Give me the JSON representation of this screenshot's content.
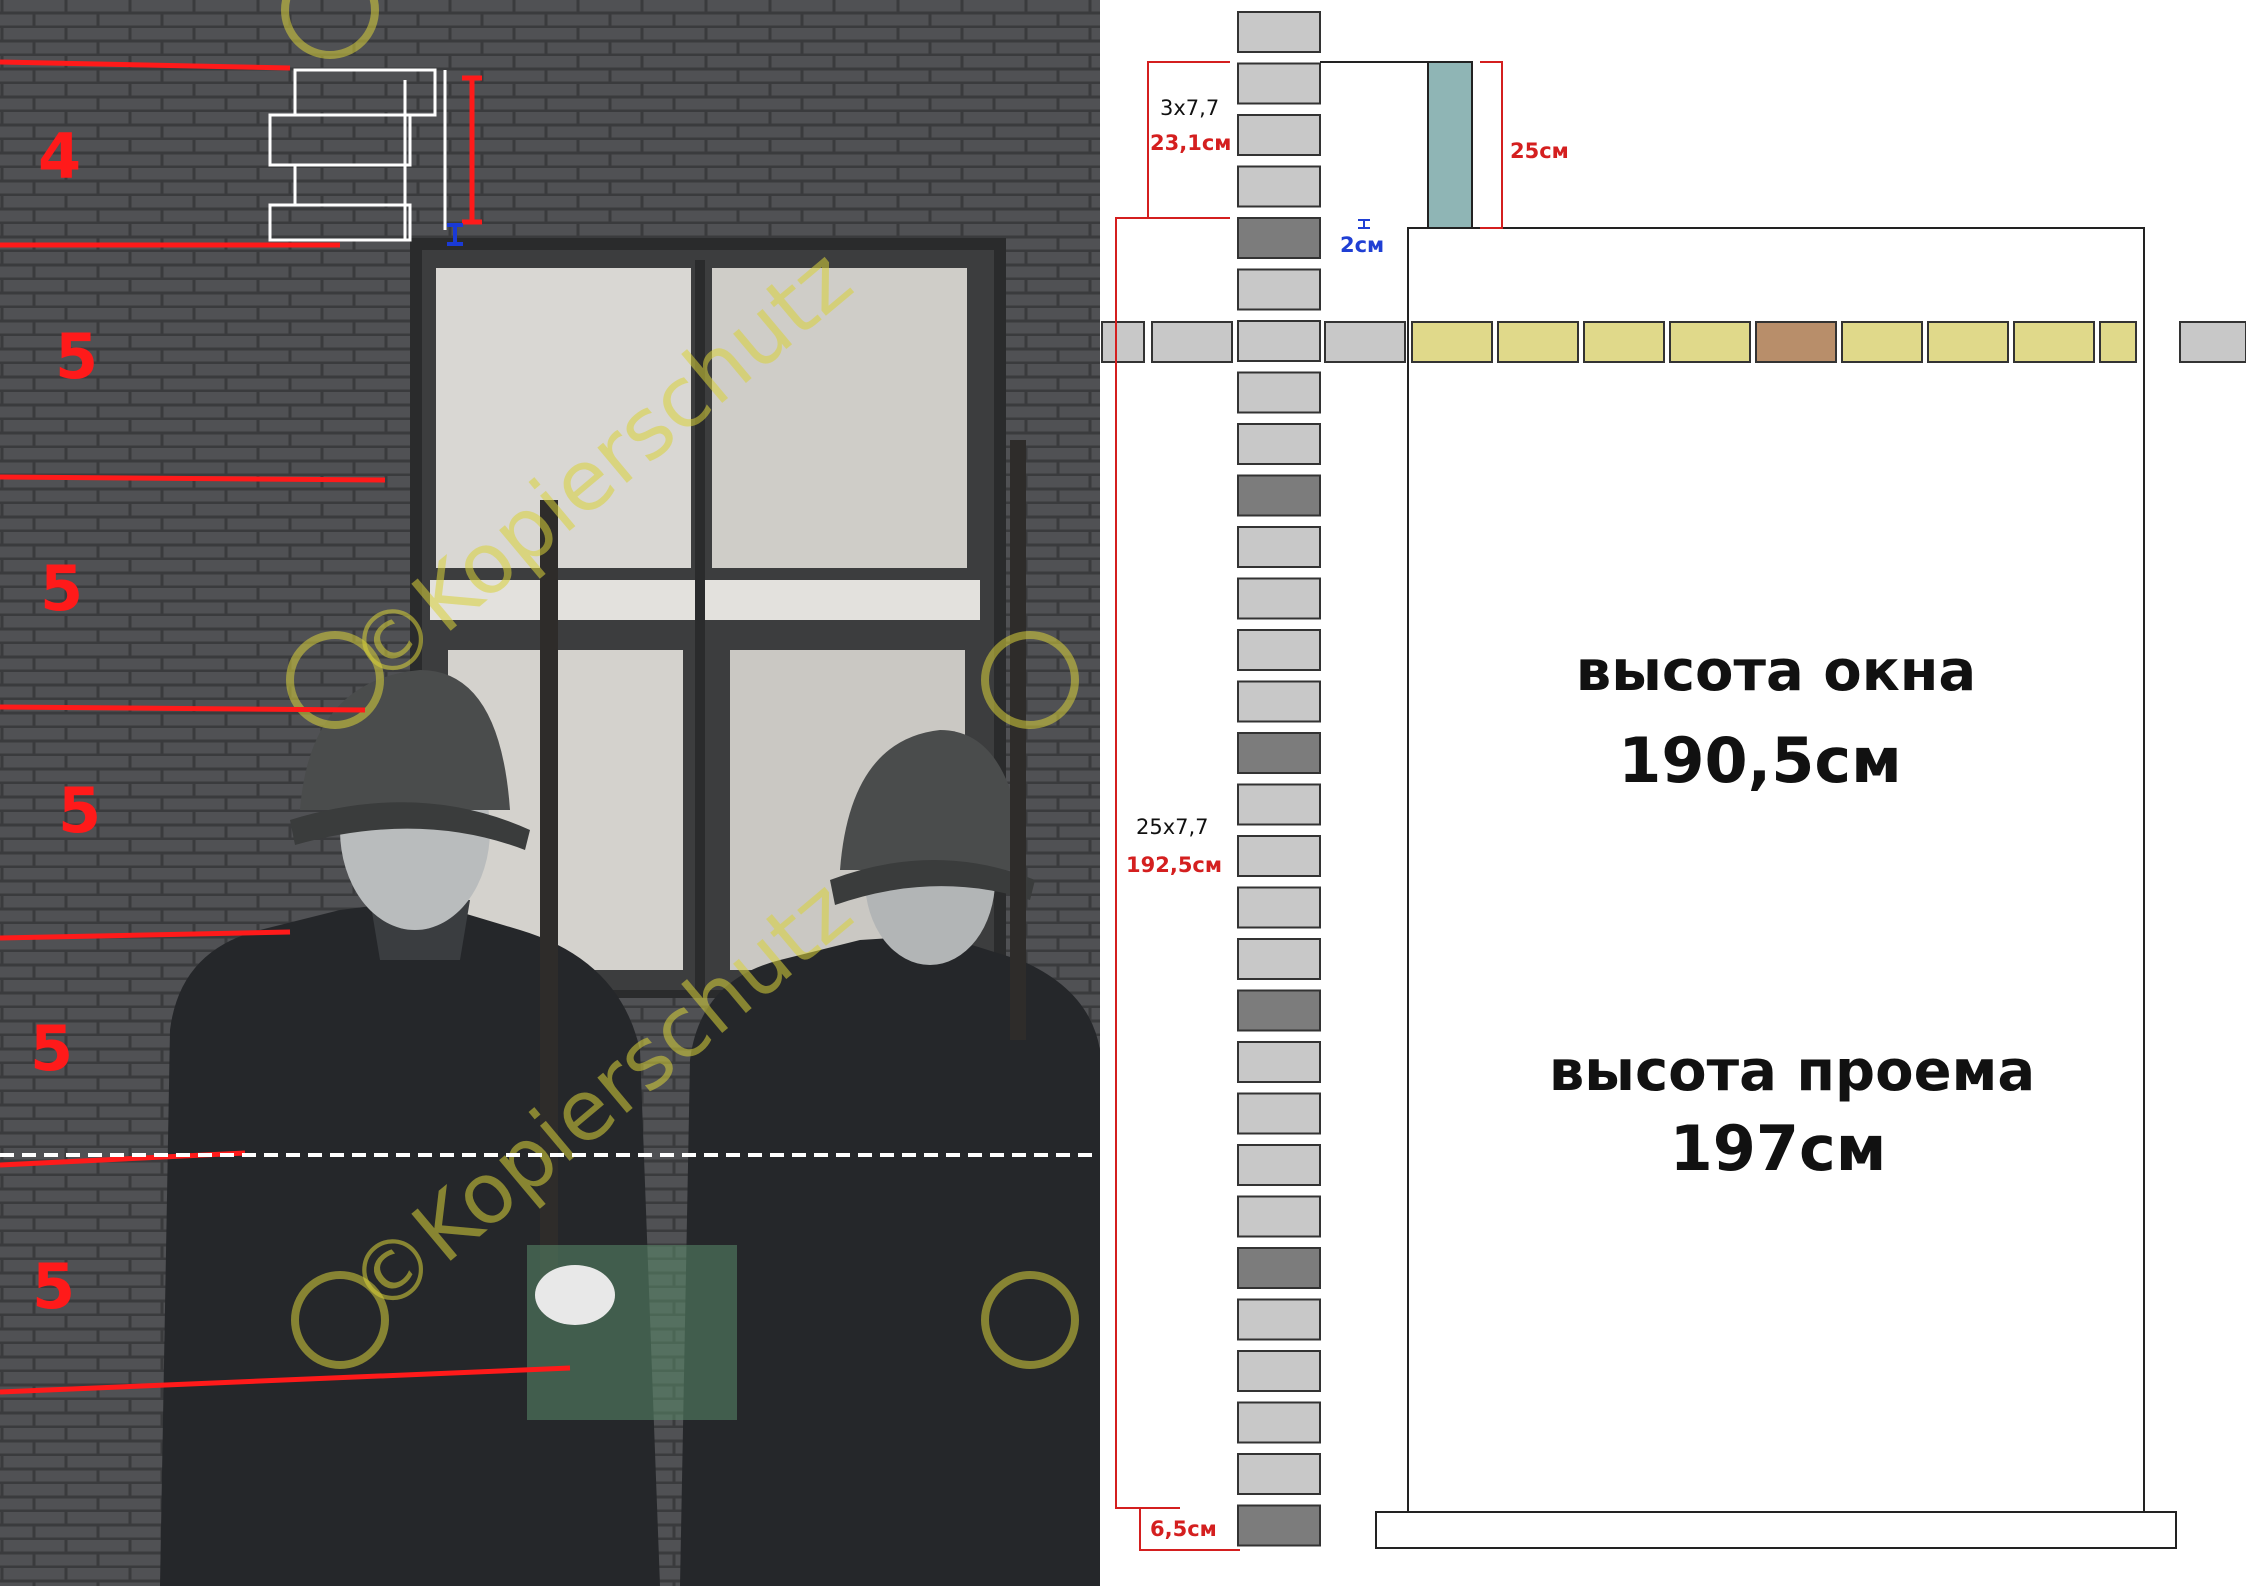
{
  "photo": {
    "course_counts": [
      "4",
      "5",
      "5",
      "5",
      "5",
      "5"
    ],
    "watermark_text": "©Kopierschutz",
    "colors": {
      "annotation_red": "#ff1a1a",
      "annotation_white": "#ffffff",
      "annotation_blue": "#1a3ad6",
      "watermark": "#d9d23a"
    }
  },
  "diagram": {
    "top_segment": {
      "formula": "3х7,7",
      "value": "23,1см"
    },
    "top_board_height": "25см",
    "gap": "2см",
    "main_segment": {
      "formula": "25х7,7",
      "value": "192,5см"
    },
    "bottom_segment": "6,5см",
    "window_height_label": "высота окна",
    "window_height_value": "190,5см",
    "opening_height_label": "высота проема",
    "opening_height_value": "197см",
    "colors": {
      "brick": "#c8c8c8",
      "brick_dark": "#7c7c7c",
      "lintel_brick": "#e0d98a",
      "lintel_accent": "#b88e6a",
      "board": "#8fb5b5",
      "dim_red": "#d41f1f",
      "dim_blue": "#1f3fd4"
    }
  }
}
